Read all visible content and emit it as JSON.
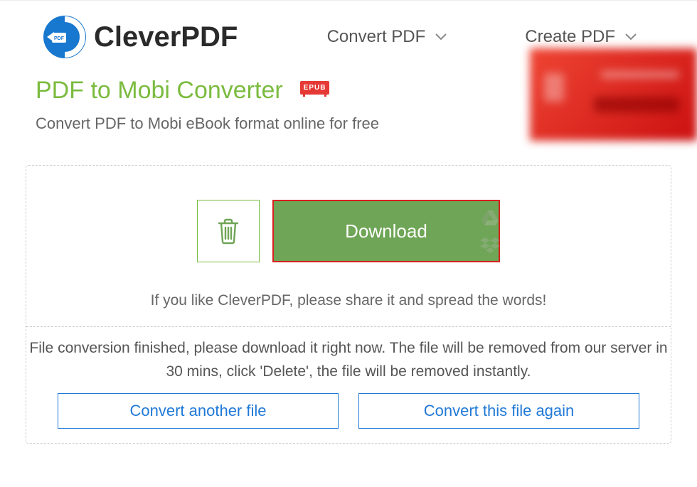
{
  "header": {
    "brand": "CleverPDF",
    "nav": {
      "convert": "Convert PDF",
      "create": "Create PDF"
    }
  },
  "page": {
    "title": "PDF to Mobi Converter",
    "badge": "EPUB",
    "subtitle": "Convert PDF to Mobi eBook format online for free"
  },
  "actions": {
    "download": "Download",
    "share_prompt": "If you like CleverPDF, please share it and spread the words!",
    "finished": "File conversion finished, please download it right now. The file will be removed from our server in 30 mins, click 'Delete', the file will be removed instantly.",
    "convert_another": "Convert another file",
    "convert_again": "Convert this file again"
  }
}
